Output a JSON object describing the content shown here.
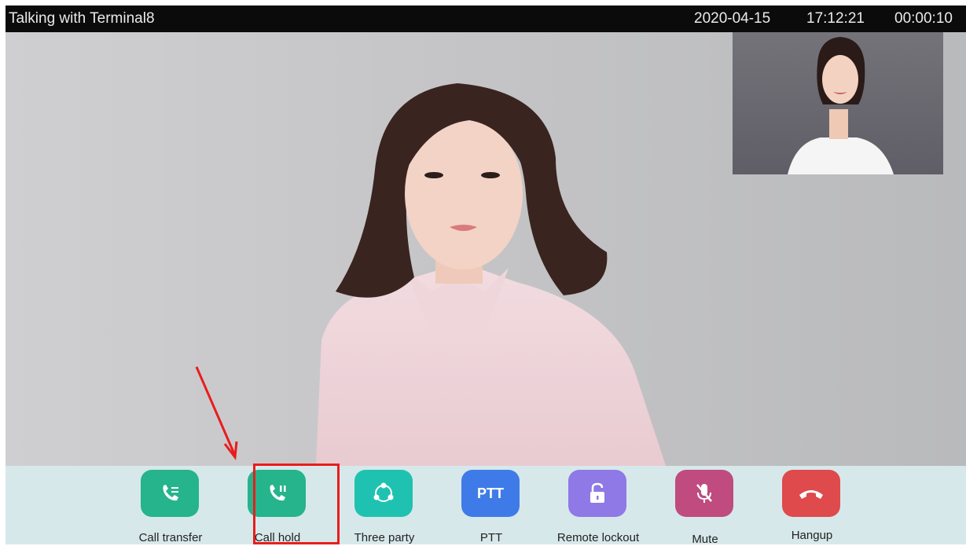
{
  "header": {
    "title": "Talking with Terminal8",
    "date": "2020-04-15",
    "time": "17:12:21",
    "duration": "00:00:10"
  },
  "toolbar": {
    "buttons": [
      {
        "label": "Call transfer",
        "icon": "call-transfer-icon",
        "color": "#25b48c"
      },
      {
        "label": "Call hold",
        "icon": "call-hold-icon",
        "color": "#25b48c"
      },
      {
        "label": "Three party",
        "icon": "three-party-icon",
        "color": "#1fc2b0"
      },
      {
        "label": "PTT",
        "icon": "ptt-icon",
        "icon_text": "PTT",
        "color": "#3f7be8"
      },
      {
        "label": "Remote lockout",
        "icon": "unlock-icon",
        "color": "#8e79e6"
      },
      {
        "label": "Mute",
        "icon": "mic-off-icon",
        "color": "#bf4b7f"
      },
      {
        "label": "Hangup",
        "icon": "hangup-icon",
        "color": "#df4a4c"
      }
    ]
  },
  "colors": {
    "topbar_bg": "#0b0b0b",
    "toolbar_bg": "#d7e8ea",
    "annotation": "#e81d1d"
  }
}
